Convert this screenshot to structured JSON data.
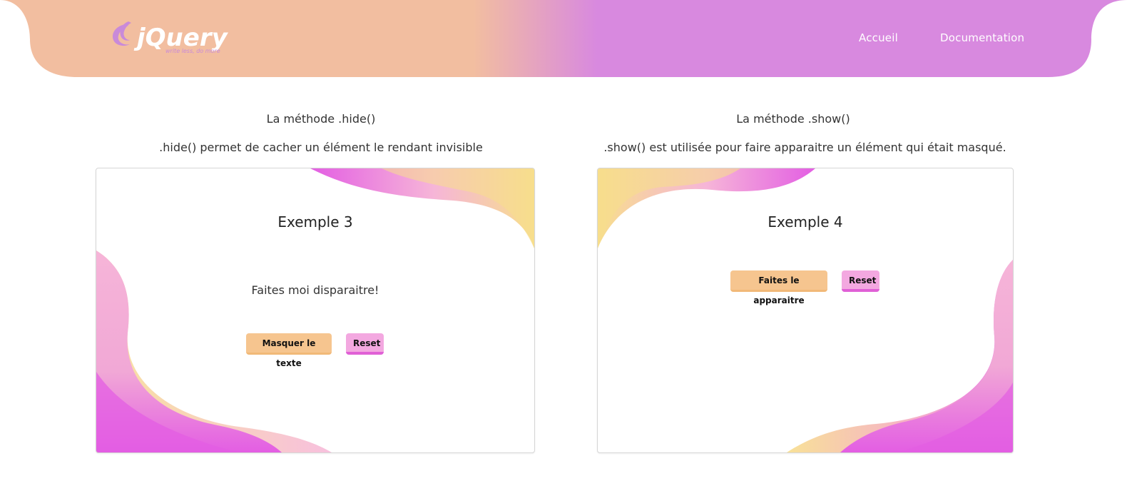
{
  "header": {
    "logo_text": "jQuery",
    "logo_tagline": "write less, do more",
    "nav": [
      {
        "label": "Accueil"
      },
      {
        "label": "Documentation"
      }
    ],
    "colors": {
      "left": "#f2bea0",
      "right": "#d889df"
    }
  },
  "sections": [
    {
      "title": "La méthode .hide()",
      "description": ".hide() permet de cacher un élément le rendant invisible",
      "card": {
        "title": "Exemple 3",
        "text": "Faites moi disparaitre!",
        "primary_button": "Masquer le texte",
        "reset_button": "Reset"
      }
    },
    {
      "title": "La méthode .show()",
      "description": ".show() est utilisée pour faire apparaitre un élément qui était masqué.",
      "card": {
        "title": "Exemple 4",
        "primary_button": "Faites le apparaitre",
        "reset_button": "Reset"
      }
    }
  ],
  "colors": {
    "orange_button": "#f6c58f",
    "pink_button": "#f3a8e0",
    "wave_magenta": "#e35ee3",
    "wave_yellow": "#f7de8c",
    "wave_pink": "#f6b5d8"
  }
}
